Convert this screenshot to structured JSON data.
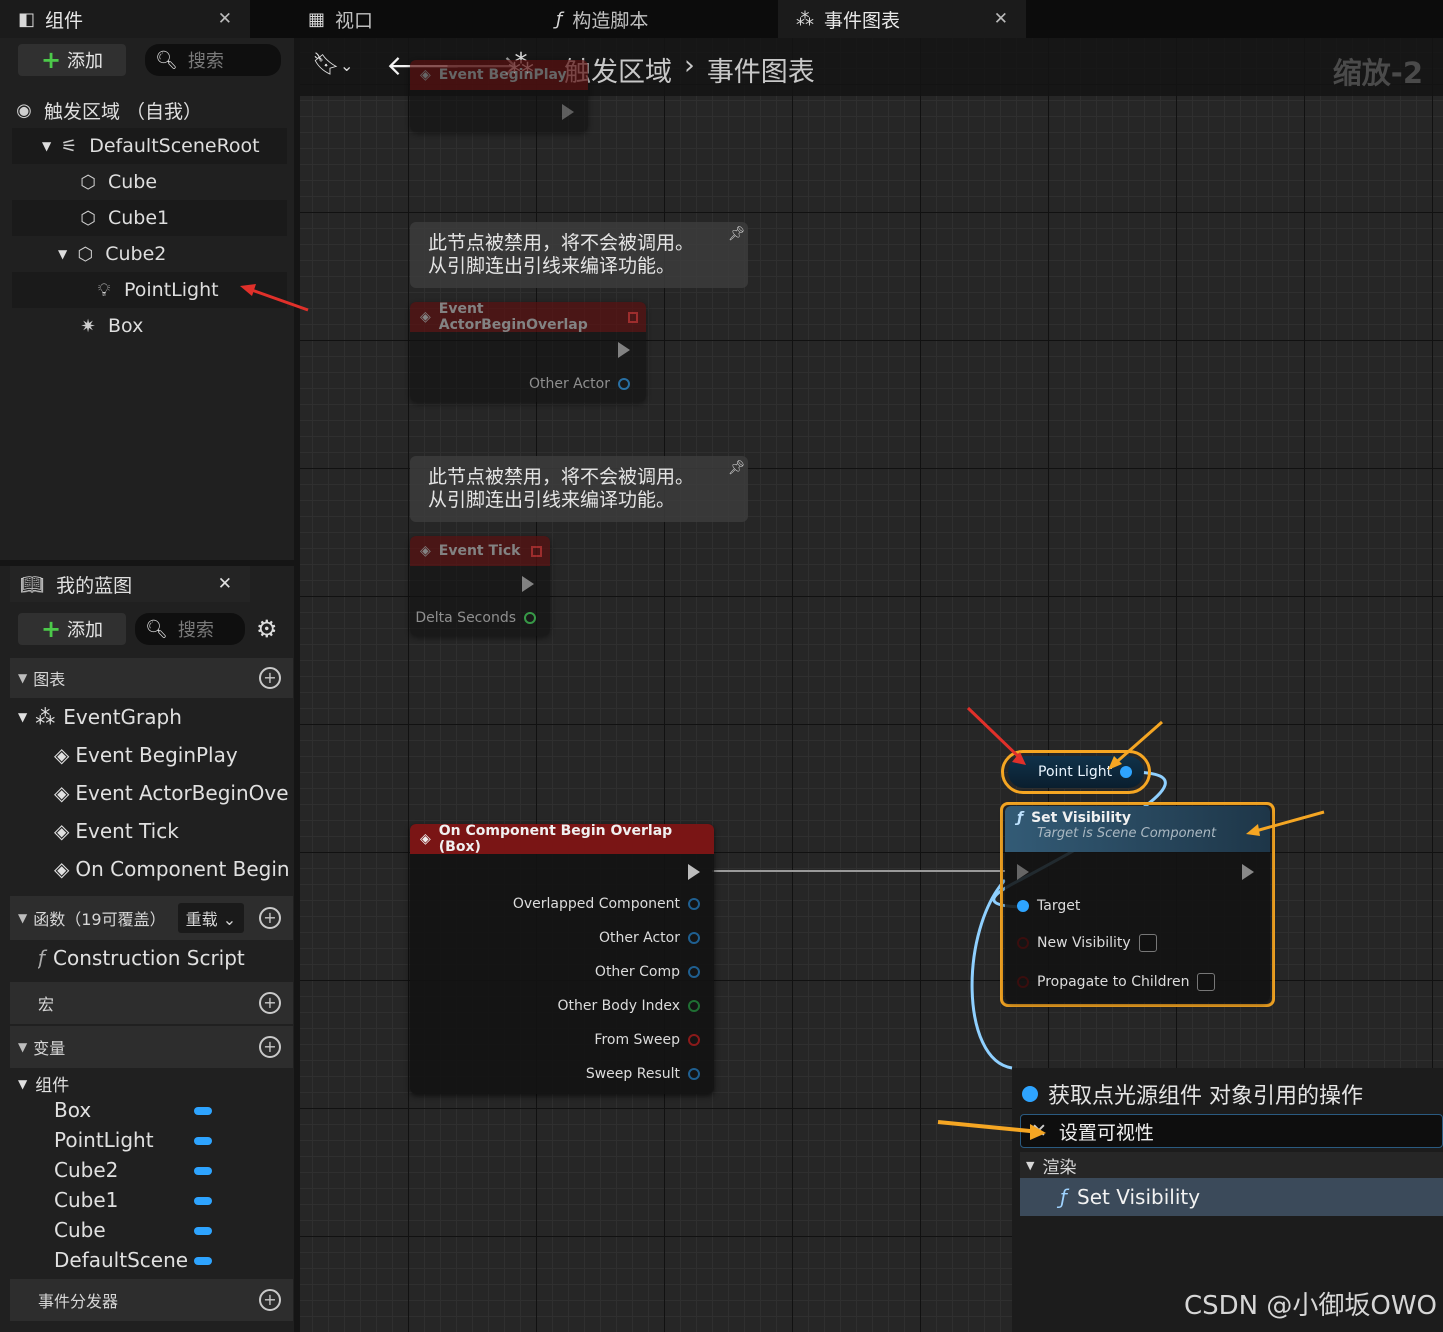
{
  "tabs": {
    "components": "组件",
    "viewport": "视口",
    "construction": "构造脚本",
    "event_graph": "事件图表"
  },
  "components_panel": {
    "add_label": "添加",
    "search_placeholder": "搜索",
    "root": "触发区域 （自我）",
    "tree": [
      "DefaultSceneRoot",
      "Cube",
      "Cube1",
      "Cube2",
      "PointLight",
      "Box"
    ]
  },
  "my_blueprint": {
    "title": "我的蓝图",
    "add_label": "添加",
    "search_placeholder": "搜索",
    "graphs_label": "图表",
    "event_graph": "EventGraph",
    "events": [
      "Event BeginPlay",
      "Event ActorBeginOverla",
      "Event Tick",
      "On Component Begin O"
    ],
    "functions_label": "函数（19可覆盖）",
    "override_label": "重载",
    "construction_script": "Construction Script",
    "macros_label": "宏",
    "variables_label": "变量",
    "components_group": "组件",
    "variables": [
      "Box",
      "PointLight",
      "Cube2",
      "Cube1",
      "Cube",
      "DefaultSceneR"
    ],
    "dispatchers_label": "事件分发器"
  },
  "toolbar": {
    "breadcrumb_root": "触发区域",
    "breadcrumb_leaf": "事件图表",
    "zoom": "缩放-2"
  },
  "graph": {
    "disabled_comment": "此节点被禁用，将不会被调用。\n从引脚连出引线来编译功能。",
    "event_beginplay": "Event BeginPlay",
    "event_actor_overlap": "Event ActorBeginOverlap",
    "other_actor": "Other Actor",
    "event_tick": "Event Tick",
    "delta_seconds": "Delta Seconds",
    "overlap_node_title": "On Component Begin Overlap (Box)",
    "overlap_pins": [
      "Overlapped Component",
      "Other Actor",
      "Other Comp",
      "Other Body Index",
      "From Sweep",
      "Sweep Result"
    ],
    "point_light_var": "Point Light",
    "set_visibility_title": "Set Visibility",
    "set_visibility_subtitle": "Target is Scene Component",
    "target_pin": "Target",
    "new_visibility_pin": "New Visibility",
    "propagate_pin": "Propagate to Children"
  },
  "action_menu": {
    "header": "获取点光源组件 对象引用的操作",
    "search_value": "设置可视性",
    "category": "渲染",
    "result": "Set Visibility"
  },
  "watermark": "CSDN @小御坂OWO",
  "colors": {
    "accent_blue": "#2ea4ff",
    "highlight_orange": "#f5a623",
    "event_red": "#7a1515",
    "annotation_red": "#e0302a"
  }
}
